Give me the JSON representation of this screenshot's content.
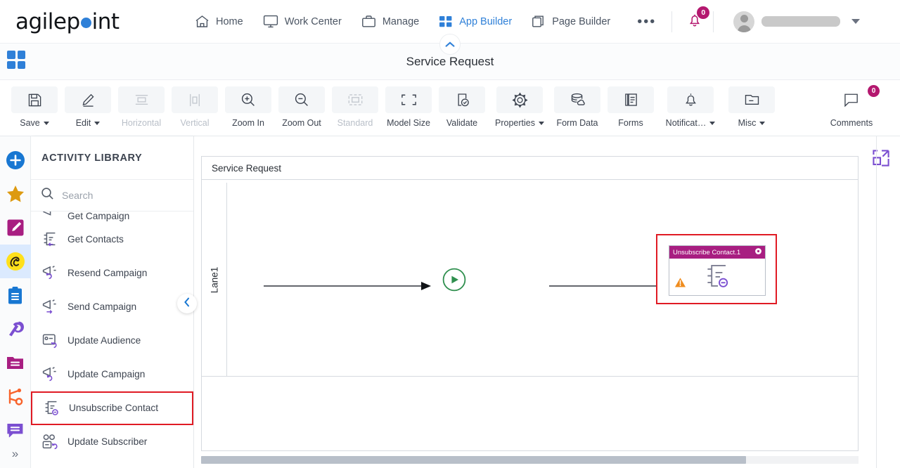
{
  "brand": {
    "name_pre": "agilep",
    "name_post": "int",
    "accent_blue": "#2f80d8",
    "accent_magenta": "#b4186f",
    "accent_purple": "#7b4fd1",
    "warning_orange": "#ef8c1e",
    "error_red": "#e01b24"
  },
  "topnav": {
    "items": [
      {
        "label": "Home",
        "icon": "home-icon",
        "active": false
      },
      {
        "label": "Work Center",
        "icon": "monitor-icon",
        "active": false
      },
      {
        "label": "Manage",
        "icon": "briefcase-icon",
        "active": false
      },
      {
        "label": "App Builder",
        "icon": "grid-icon",
        "active": true
      },
      {
        "label": "Page Builder",
        "icon": "pages-icon",
        "active": false
      }
    ],
    "more_label": "•••",
    "notifications_count": "0",
    "user_name": ""
  },
  "titlebar": {
    "title": "Service Request",
    "grid_icon": "apps-grid-icon",
    "collapse_icon": "chevron-up-icon"
  },
  "toolbar": {
    "buttons": [
      {
        "label": "Save",
        "icon": "save-icon",
        "caret": true,
        "disabled": false,
        "boxed": true
      },
      {
        "label": "Edit",
        "icon": "pencil-icon",
        "caret": true,
        "disabled": false,
        "boxed": true
      },
      {
        "label": "Horizontal",
        "icon": "horizontal-align-icon",
        "caret": false,
        "disabled": true,
        "boxed": true
      },
      {
        "label": "Vertical",
        "icon": "vertical-align-icon",
        "caret": false,
        "disabled": true,
        "boxed": true
      },
      {
        "label": "Zoom In",
        "icon": "zoom-in-icon",
        "caret": false,
        "disabled": false,
        "boxed": true
      },
      {
        "label": "Zoom Out",
        "icon": "zoom-out-icon",
        "caret": false,
        "disabled": false,
        "boxed": true
      },
      {
        "label": "Standard",
        "icon": "standard-size-icon",
        "caret": false,
        "disabled": true,
        "boxed": true
      },
      {
        "label": "Model Size",
        "icon": "model-size-icon",
        "caret": false,
        "disabled": false,
        "boxed": true
      },
      {
        "label": "Validate",
        "icon": "validate-icon",
        "caret": false,
        "disabled": false,
        "boxed": true
      },
      {
        "label": "Properties",
        "icon": "gear-icon",
        "caret": true,
        "disabled": false,
        "boxed": true
      },
      {
        "label": "Form Data",
        "icon": "database-icon",
        "caret": false,
        "disabled": false,
        "boxed": true
      },
      {
        "label": "Forms",
        "icon": "forms-icon",
        "caret": false,
        "disabled": false,
        "boxed": true
      },
      {
        "label": "Notificat…",
        "icon": "bell-icon",
        "caret": true,
        "disabled": false,
        "boxed": true
      },
      {
        "label": "Misc",
        "icon": "folder-icon",
        "caret": true,
        "disabled": false,
        "boxed": true
      }
    ],
    "comments": {
      "label": "Comments",
      "icon": "comment-icon",
      "count": "0"
    }
  },
  "rail": {
    "items": [
      {
        "name": "add-icon",
        "selected": false
      },
      {
        "name": "favorites-star-icon",
        "selected": false
      },
      {
        "name": "edit-square-icon",
        "selected": false
      },
      {
        "name": "mailchimp-icon",
        "selected": true
      },
      {
        "name": "clipboard-icon",
        "selected": false
      },
      {
        "name": "constant-contact-icon",
        "selected": false
      },
      {
        "name": "folder-icon",
        "selected": false
      },
      {
        "name": "hubspot-icon",
        "selected": false
      },
      {
        "name": "chat-icon",
        "selected": false
      }
    ],
    "expand_label": "»"
  },
  "panel": {
    "header": "ACTIVITY LIBRARY",
    "search_placeholder": "Search",
    "search_value": "",
    "collapse_icon": "chevron-left-icon",
    "items": [
      {
        "label": "Get Campaign",
        "icon": "get-campaign-icon",
        "highlighted": false,
        "clipped": true
      },
      {
        "label": "Get Contacts",
        "icon": "get-contacts-icon",
        "highlighted": false,
        "clipped": false
      },
      {
        "label": "Resend Campaign",
        "icon": "resend-campaign-icon",
        "highlighted": false,
        "clipped": false
      },
      {
        "label": "Send Campaign",
        "icon": "send-campaign-icon",
        "highlighted": false,
        "clipped": false
      },
      {
        "label": "Update Audience",
        "icon": "update-audience-icon",
        "highlighted": false,
        "clipped": false
      },
      {
        "label": "Update Campaign",
        "icon": "update-campaign-icon",
        "highlighted": false,
        "clipped": false
      },
      {
        "label": "Unsubscribe Contact",
        "icon": "unsubscribe-contact-icon",
        "highlighted": true,
        "clipped": false
      },
      {
        "label": "Update Subscriber",
        "icon": "update-subscriber-icon",
        "highlighted": false,
        "clipped": false
      }
    ]
  },
  "canvas": {
    "pool_title": "Service Request",
    "lane_label": "Lane1",
    "expand_icon": "expand-canvas-icon",
    "start_event": {
      "name": "start-event",
      "icon": "play-icon"
    },
    "end_event": {
      "name": "end-event",
      "icon": "stop-icon"
    },
    "activity": {
      "title": "Unsubscribe Contact.1",
      "gear_icon": "gear-icon",
      "warning_icon": "warning-icon",
      "body_icon": "unsubscribe-contact-icon",
      "highlighted": true
    }
  }
}
